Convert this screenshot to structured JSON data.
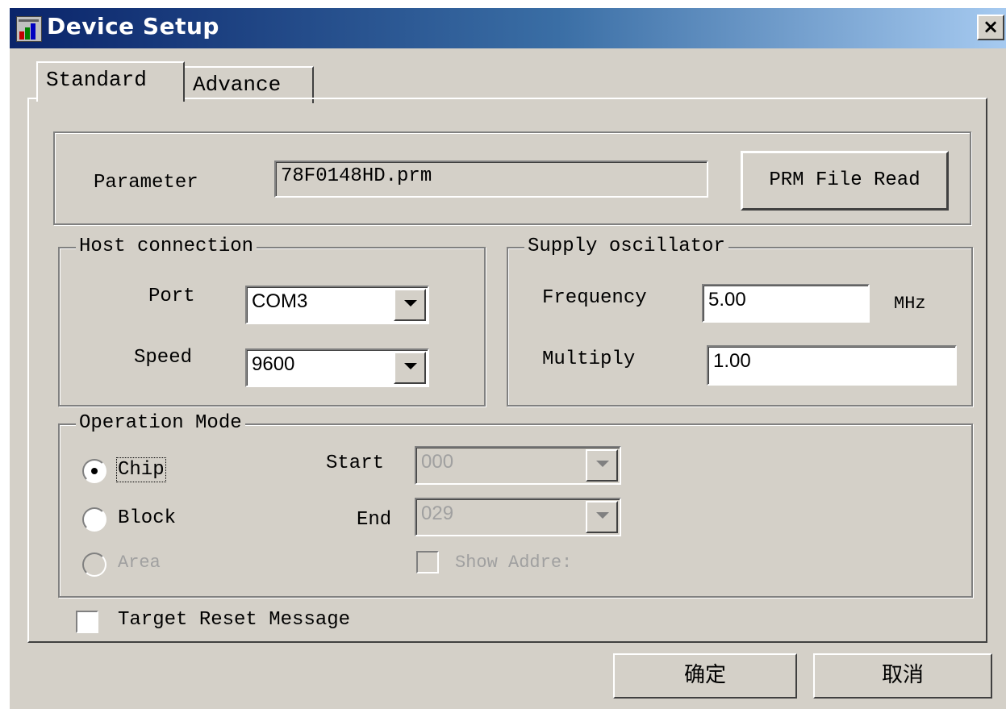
{
  "window": {
    "title": "Device Setup",
    "close_glyph": "×",
    "icon": "app-icon"
  },
  "tabs": [
    {
      "label": "Standard",
      "active": true
    },
    {
      "label": "Advance",
      "active": false
    }
  ],
  "parameter": {
    "label": "Parameter",
    "value": "78F0148HD.prm",
    "read_button": "PRM File Read"
  },
  "host": {
    "title": "Host connection",
    "port_label": "Port",
    "port_value": "COM3",
    "speed_label": "Speed",
    "speed_value": "9600"
  },
  "supply": {
    "title": "Supply oscillator",
    "frequency_label": "Frequency",
    "frequency_value": "5.00",
    "frequency_unit": "MHz",
    "multiply_label": "Multiply",
    "multiply_value": "1.00"
  },
  "operation": {
    "title": "Operation Mode",
    "modes": [
      {
        "label": "Chip",
        "checked": true
      },
      {
        "label": "Block",
        "checked": false
      },
      {
        "label": "Area",
        "checked": false,
        "disabled": true
      }
    ],
    "start_label": "Start",
    "start_value": "000",
    "end_label": "End",
    "end_value": "029",
    "show_address_label": "Show Addre:"
  },
  "target_reset_label": "Target Reset Message",
  "buttons": {
    "ok": "确定",
    "cancel": "取消"
  },
  "colors": {
    "face": "#d4d0c8",
    "title_start": "#0a246a",
    "title_end": "#a6caf0"
  }
}
